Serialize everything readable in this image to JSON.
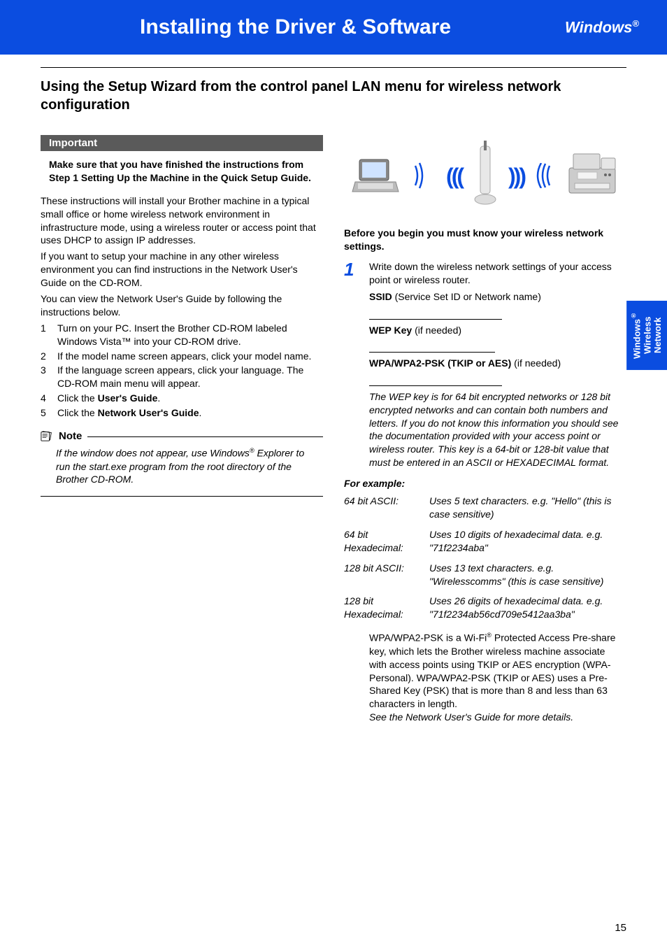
{
  "header": {
    "title": "Installing the Driver & Software",
    "os": "Windows",
    "reg": "®"
  },
  "section_title": "Using the Setup Wizard from the control panel LAN menu for wireless network configuration",
  "important": {
    "label": "Important",
    "text": "Make sure that you have finished the instructions from Step 1 Setting Up the Machine in the Quick Setup Guide."
  },
  "left": {
    "p1": "These instructions will install your Brother machine in a typical small office or home wireless network environment in infrastructure mode, using a wireless router or access point that uses DHCP to assign IP addresses.",
    "p2": "If you want to setup your machine in any other wireless environment you can find instructions in the Network User's Guide on the CD-ROM.",
    "p3": "You can view the Network User's Guide by following the instructions below.",
    "list": [
      "Turn on your PC. Insert the Brother CD-ROM labeled Windows Vista™ into your CD-ROM drive.",
      "If the model name screen appears, click your model name.",
      "If the language screen appears, click your language. The CD-ROM main menu will appear."
    ],
    "li4_pre": "Click the ",
    "li4_bold": "User's Guide",
    "li4_post": ".",
    "li5_pre": "Click the ",
    "li5_bold": "Network User's Guide",
    "li5_post": "."
  },
  "note": {
    "label": "Note",
    "body_pre": "If the window does not appear, use Windows",
    "body_post": " Explorer to run the start.exe program from the root directory of the Brother CD-ROM.",
    "reg": "®"
  },
  "right": {
    "before": "Before you begin you must know your wireless network settings.",
    "step1": {
      "num": "1",
      "intro": "Write down the wireless network settings of your access point or wireless router.",
      "ssid_bold": "SSID",
      "ssid_rest": " (Service Set ID or Network name)",
      "wep_bold": "WEP Key",
      "wep_rest": " (if needed)",
      "wpa_bold": "WPA/WPA2-PSK (TKIP or AES)",
      "wpa_rest": " (if needed)",
      "keynote": "The WEP key is for 64 bit encrypted networks or 128 bit encrypted networks and can contain both numbers and letters. If you do not know this information you should see the documentation provided with your access point or wireless router. This key is a 64-bit or 128-bit value that must be entered in an ASCII or HEXADECIMAL format."
    },
    "for_example": "For example:",
    "examples": [
      {
        "k": "64 bit ASCII:",
        "v": "Uses 5 text characters.  e.g. \"Hello\" (this is case sensitive)"
      },
      {
        "k": "64 bit Hexadecimal:",
        "v": "Uses 10 digits of hexadecimal data. e.g. \"71f2234aba\""
      },
      {
        "k": "128 bit ASCII:",
        "v": "Uses 13 text characters.  e.g. \"Wirelesscomms\" (this is case sensitive)"
      },
      {
        "k": "128 bit Hexadecimal:",
        "v": "Uses 26 digits of hexadecimal data. e.g. \"71f2234ab56cd709e5412aa3ba\""
      }
    ],
    "wpa_p1a": "WPA/WPA2-PSK is a Wi-Fi",
    "wpa_reg": "®",
    "wpa_p1b": " Protected Access Pre-share key, which lets the Brother wireless machine associate with access points using TKIP or AES encryption (WPA-Personal). WPA/WPA2-PSK (TKIP or AES) uses a Pre-Shared Key (PSK) that is more than 8 and less than 63 characters in length.",
    "wpa_p2": "See the Network User's Guide for more details."
  },
  "side_tab": {
    "l1a": "Windows",
    "l1b": "®",
    "l2": "Wireless",
    "l3": "Network"
  },
  "page_number": "15"
}
